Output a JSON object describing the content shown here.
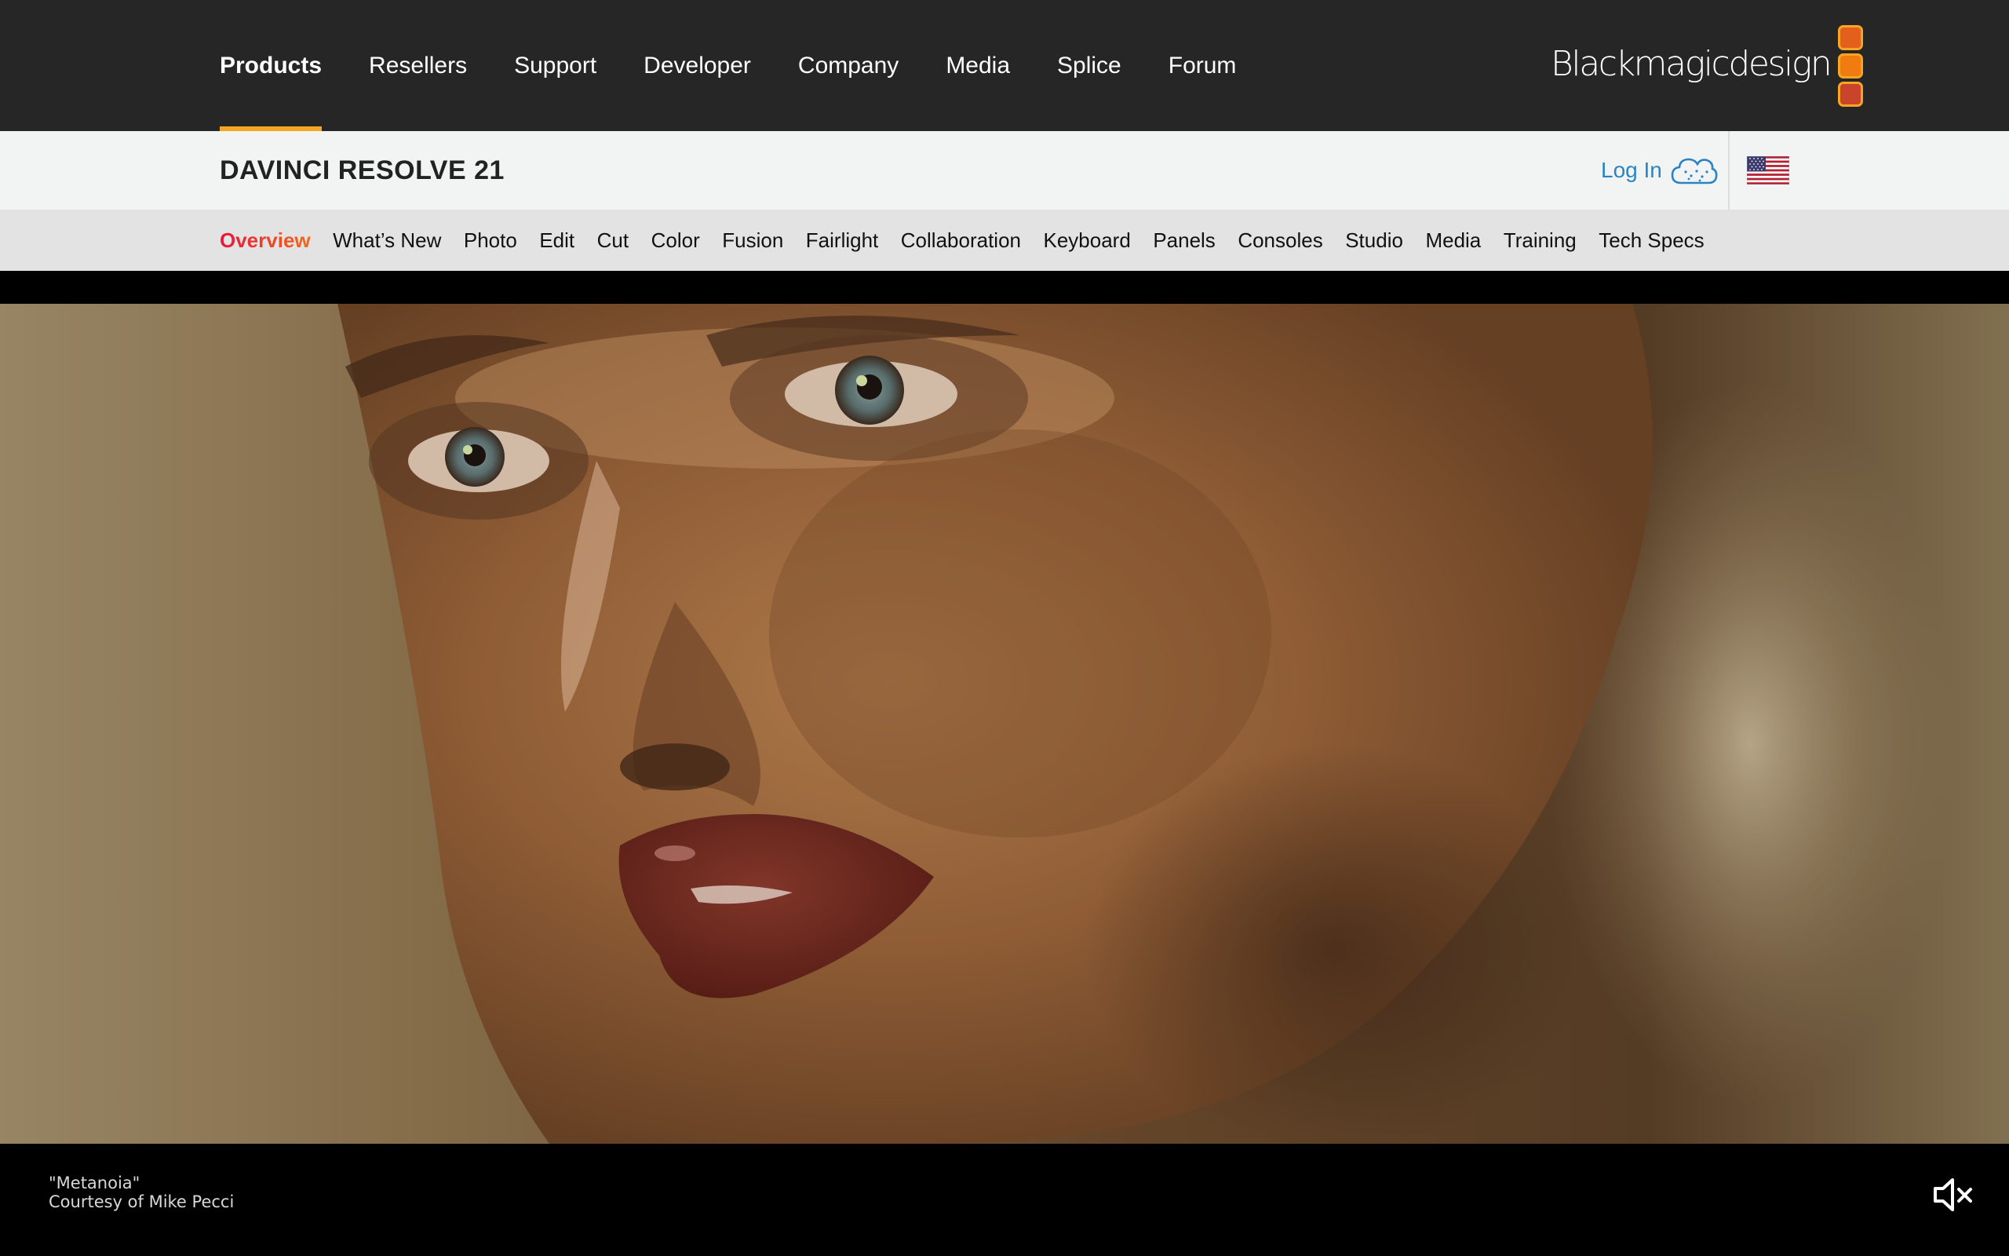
{
  "main_nav": {
    "items": [
      {
        "label": "Products",
        "active": true
      },
      {
        "label": "Resellers"
      },
      {
        "label": "Support"
      },
      {
        "label": "Developer"
      },
      {
        "label": "Company"
      },
      {
        "label": "Media"
      },
      {
        "label": "Splice"
      },
      {
        "label": "Forum"
      }
    ]
  },
  "brand": {
    "logo_text": "Blackmagicdesign",
    "icon": "three-rounded-squares-logo"
  },
  "product": {
    "title": "DAVINCI RESOLVE 21"
  },
  "account": {
    "login_label": "Log In",
    "icon": "cloud-icon"
  },
  "region": {
    "icon": "us-flag-icon"
  },
  "sub_nav": {
    "items": [
      {
        "label": "Overview",
        "active": true
      },
      {
        "label": "What’s New"
      },
      {
        "label": "Photo"
      },
      {
        "label": "Edit"
      },
      {
        "label": "Cut"
      },
      {
        "label": "Color"
      },
      {
        "label": "Fusion"
      },
      {
        "label": "Fairlight"
      },
      {
        "label": "Collaboration"
      },
      {
        "label": "Keyboard"
      },
      {
        "label": "Panels"
      },
      {
        "label": "Consoles"
      },
      {
        "label": "Studio"
      },
      {
        "label": "Media"
      },
      {
        "label": "Training"
      },
      {
        "label": "Tech Specs"
      }
    ]
  },
  "hero": {
    "caption_title": "\"Metanoia\"",
    "caption_credit": "Courtesy of Mike Pecci",
    "mute_icon": "speaker-muted-icon"
  },
  "colors": {
    "topbar": "#262626",
    "accent": "#f6a623",
    "active_subnav": "#e8153c",
    "login_blue": "#2a84c4"
  }
}
